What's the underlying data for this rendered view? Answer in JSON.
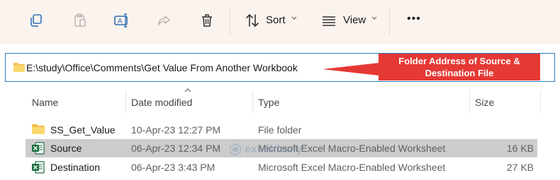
{
  "toolbar": {
    "sort_label": "Sort",
    "view_label": "View",
    "more_label": "•••"
  },
  "address": {
    "path": "E:\\study\\Office\\Comments\\Get Value From Another Workbook"
  },
  "callout": {
    "text": "Folder Address of Source & Destination File",
    "color": "#e53935"
  },
  "columns": {
    "name": "Name",
    "date": "Date modified",
    "type": "Type",
    "size": "Size"
  },
  "files": [
    {
      "name": "SS_Get_Value",
      "date": "10-Apr-23 12:27 PM",
      "type": "File folder",
      "size": "",
      "icon": "folder-icon"
    },
    {
      "name": "Source",
      "date": "06-Apr-23 12:34 PM",
      "type": "Microsoft Excel Macro-Enabled Worksheet",
      "size": "16 KB",
      "icon": "excel-file-icon",
      "selected": true
    },
    {
      "name": "Destination",
      "date": "06-Apr-23 3:43 PM",
      "type": "Microsoft Excel Macro-Enabled Worksheet",
      "size": "27 KB",
      "icon": "excel-file-icon"
    }
  ],
  "watermark": {
    "text": "exceldemy"
  }
}
